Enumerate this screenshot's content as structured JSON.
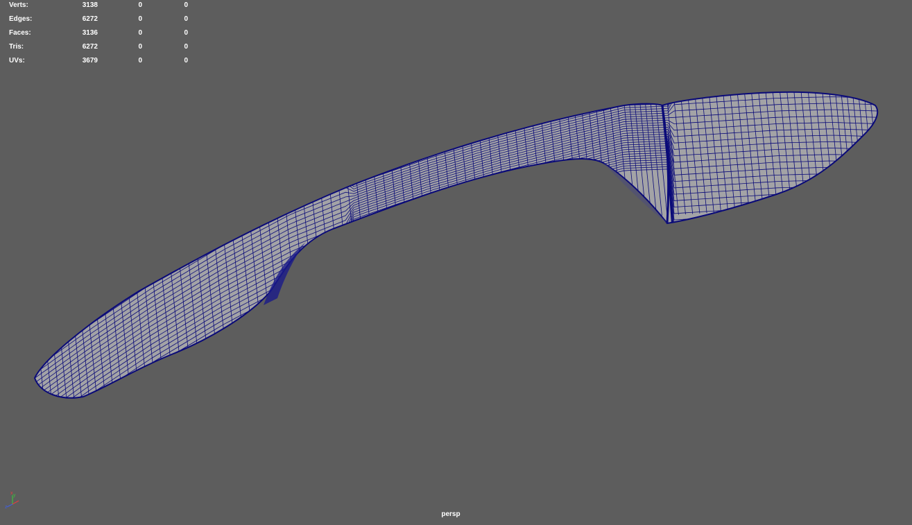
{
  "hud": {
    "rows": [
      {
        "label": "Verts:",
        "total": "3138",
        "selected": "0",
        "component": "0"
      },
      {
        "label": "Edges:",
        "total": "6272",
        "selected": "0",
        "component": "0"
      },
      {
        "label": "Faces:",
        "total": "3136",
        "selected": "0",
        "component": "0"
      },
      {
        "label": "Tris:",
        "total": "6272",
        "selected": "0",
        "component": "0"
      },
      {
        "label": "UVs:",
        "total": "3679",
        "selected": "0",
        "component": "0"
      }
    ]
  },
  "viewport": {
    "camera": "persp",
    "background_color": "#5d5d5d",
    "mesh_fill_color": "#a3a3a6",
    "wire_color": "#0a0a78"
  },
  "axis_gizmo": {
    "x": "x",
    "y": "y",
    "z": "z"
  }
}
